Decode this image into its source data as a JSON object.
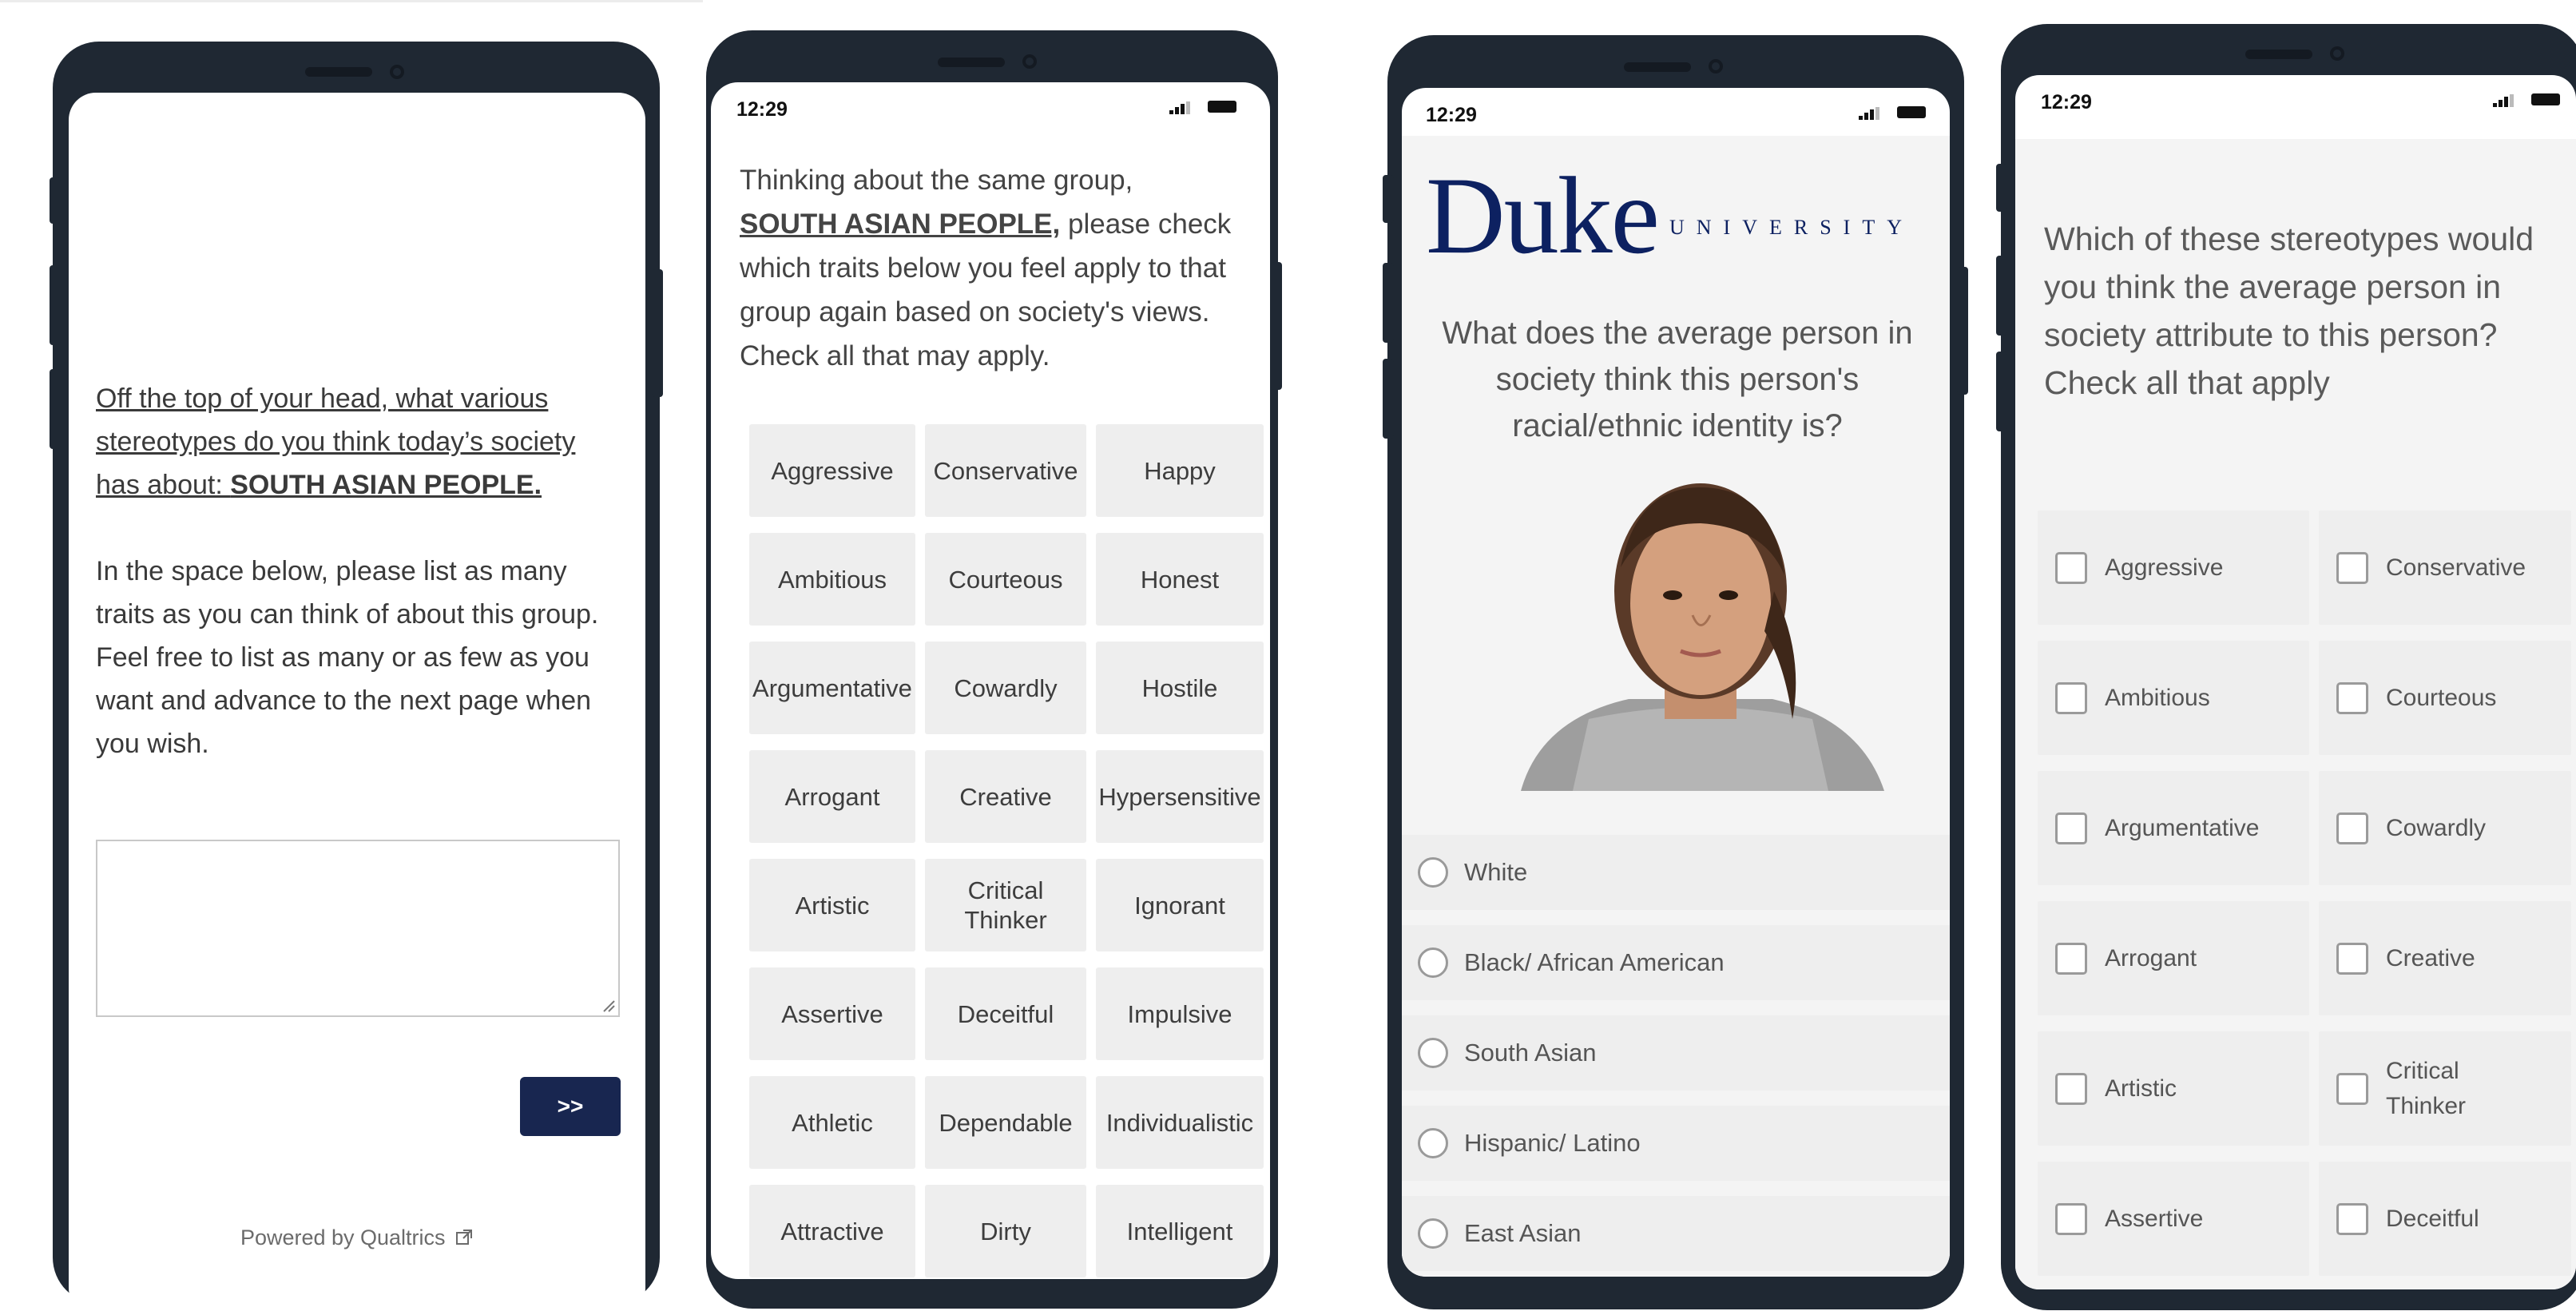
{
  "status_time": "12:29",
  "phone1": {
    "prompt_prefix": "Off the top of your head, what various stereotypes do you think today’s society has about: ",
    "group": "SOUTH ASIAN PEOPLE.",
    "instructions": "In the space below, please list as many traits as you can think of about this group. Feel free to list as many or as few as you want and advance to the next page when you wish.",
    "textarea_value": "",
    "next_label": ">>",
    "powered_by": "Powered by Qualtrics"
  },
  "phone2": {
    "intro": "Thinking about the same group,",
    "group": "SOUTH ASIAN PEOPLE,",
    "instructions": " please check which traits below you feel apply to that group again based on society's views. Check all that may apply.",
    "traits": [
      "Aggressive",
      "Conservative",
      "Happy",
      "Ambitious",
      "Courteous",
      "Honest",
      "Argumentative",
      "Cowardly",
      "Hostile",
      "Arrogant",
      "Creative",
      "Hypersensitive",
      "Artistic",
      "Critical\nThinker",
      "Ignorant",
      "Assertive",
      "Deceitful",
      "Impulsive",
      "Athletic",
      "Dependable",
      "Individualistic",
      "Attractive",
      "Dirty",
      "Intelligent"
    ]
  },
  "phone3": {
    "logo_word": "Duke",
    "logo_sub": "UNIVERSITY",
    "question": "What does the average person in society think this person's racial/ethnic identity is?",
    "options": [
      "White",
      "Black/ African American",
      "South Asian",
      "Hispanic/ Latino",
      "East Asian"
    ]
  },
  "phone4": {
    "question": "Which of these stereotypes would you think the average person in society attribute to this person? Check all that apply",
    "traits": [
      "Aggressive",
      "Conservative",
      "Ambitious",
      "Courteous",
      "Argumentative",
      "Cowardly",
      "Arrogant",
      "Creative",
      "Artistic",
      "Critical\nThinker",
      "Assertive",
      "Deceitful"
    ]
  }
}
